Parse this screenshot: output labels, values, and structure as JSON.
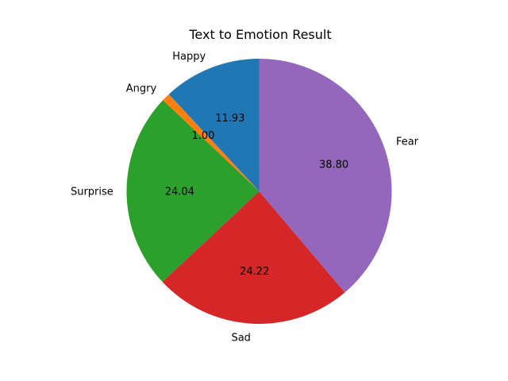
{
  "chart_data": {
    "type": "pie",
    "title": "Text to Emotion Result",
    "labels": [
      "Happy",
      "Angry",
      "Surprise",
      "Sad",
      "Fear"
    ],
    "values": [
      11.93,
      1.0,
      24.04,
      24.22,
      38.8
    ],
    "pct_labels": [
      "11.93",
      "1.00",
      "24.04",
      "24.22",
      "38.80"
    ],
    "colors": [
      "#1f77b4",
      "#ff7f0e",
      "#2ca02c",
      "#d62728",
      "#9467bd"
    ],
    "start_angle": 90,
    "direction": "counterclockwise"
  }
}
